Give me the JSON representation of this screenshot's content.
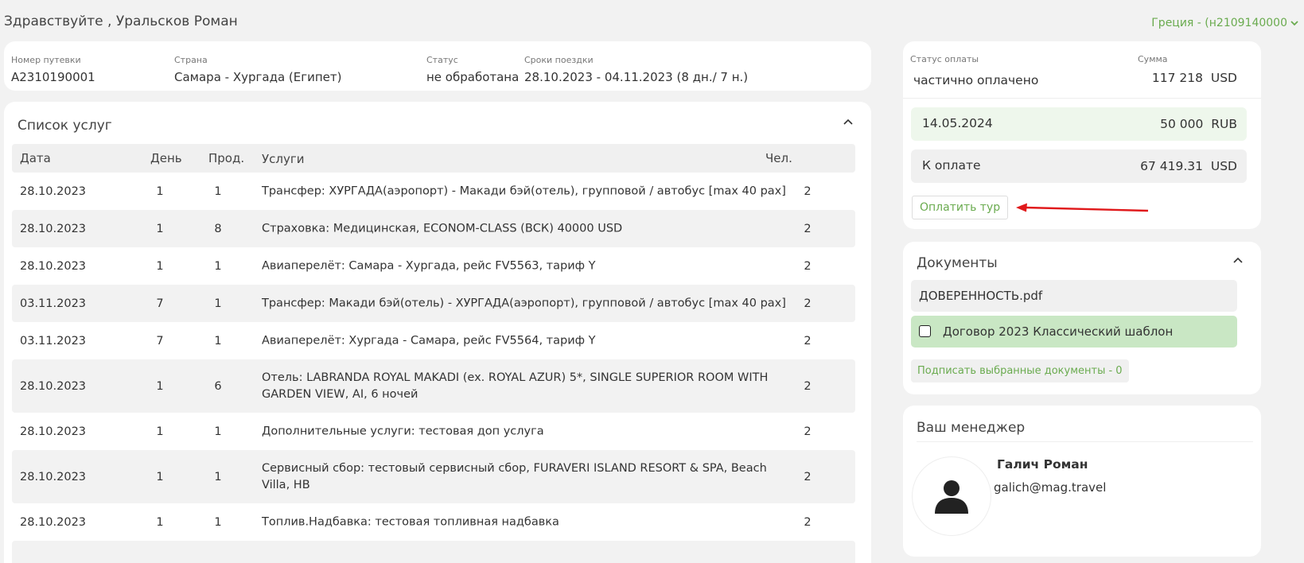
{
  "header": {
    "greeting": "Здравствуйте , Уральсков Роман",
    "region": "Греция - (н2109140000"
  },
  "trip": {
    "number_label": "Номер путевки",
    "number": "A2310190001",
    "country_label": "Страна",
    "country": "Самара - Хургада (Египет)",
    "status_label": "Статус",
    "status": "не обработана",
    "dates_label": "Сроки поездки",
    "dates": "28.10.2023 - 04.11.2023 (8 дн./ 7 н.)"
  },
  "services": {
    "title": "Список услуг",
    "columns": [
      "Дата",
      "День",
      "Прод.",
      "Услуги",
      "Чел."
    ],
    "rows": [
      {
        "date": "28.10.2023",
        "day": "1",
        "prod": "1",
        "service": "Трансфер: ХУРГАДА(аэропорт) - Макади бэй(отель), групповой / автобус [max 40 pax]",
        "pax": "2"
      },
      {
        "date": "28.10.2023",
        "day": "1",
        "prod": "8",
        "service": "Страховка: Медицинская, ECONOM-CLASS (ВСК) 40000 USD",
        "pax": "2"
      },
      {
        "date": "28.10.2023",
        "day": "1",
        "prod": "1",
        "service": "Авиаперелёт: Самара - Хургада, рейс FV5563, тариф Y",
        "pax": "2"
      },
      {
        "date": "03.11.2023",
        "day": "7",
        "prod": "1",
        "service": "Трансфер: Макади бэй(отель) - ХУРГАДА(аэропорт), групповой / автобус [max 40 pax]",
        "pax": "2"
      },
      {
        "date": "03.11.2023",
        "day": "7",
        "prod": "1",
        "service": "Авиаперелёт: Хургада - Самара, рейс FV5564, тариф Y",
        "pax": "2"
      },
      {
        "date": "28.10.2023",
        "day": "1",
        "prod": "6",
        "service": "Отель: LABRANDA ROYAL MAKADI (ex. ROYAL AZUR) 5*, SINGLE SUPERIOR ROOM WITH GARDEN VIEW, AI, 6 ночей",
        "pax": "2"
      },
      {
        "date": "28.10.2023",
        "day": "1",
        "prod": "1",
        "service": "Дополнительные услуги: тестовая доп услуга",
        "pax": "2"
      },
      {
        "date": "28.10.2023",
        "day": "1",
        "prod": "1",
        "service": "Сервисный сбор: тестовый сервисный сбор, FURAVERI ISLAND RESORT & SPA, Beach Villa, HB",
        "pax": "2"
      },
      {
        "date": "28.10.2023",
        "day": "1",
        "prod": "1",
        "service": "Топлив.Надбавка: тестовая топливная надбавка",
        "pax": "2"
      }
    ]
  },
  "payment": {
    "status_label": "Статус оплаты",
    "status": "частично оплачено",
    "sum_label": "Сумма",
    "sum": "117 218",
    "sum_currency": "USD",
    "history_date": "14.05.2024",
    "history_amount": "50 000",
    "history_currency": "RUB",
    "due_label": "К оплате",
    "due_amount": "67 419.31",
    "due_currency": "USD",
    "pay_button": "Оплатить тур"
  },
  "documents": {
    "title": "Документы",
    "file": "ДОВЕРЕННОСТЬ.pdf",
    "contract": "Договор 2023 Классический шаблон",
    "sign_button": "Подписать выбранные документы - 0"
  },
  "manager": {
    "title": "Ваш менеджер",
    "name": "Галич Роман",
    "email": "galich@mag.travel"
  },
  "colors": {
    "accent": "#6aab4f",
    "contract_bg": "#c9e7c4",
    "arrow": "#e0191b"
  }
}
